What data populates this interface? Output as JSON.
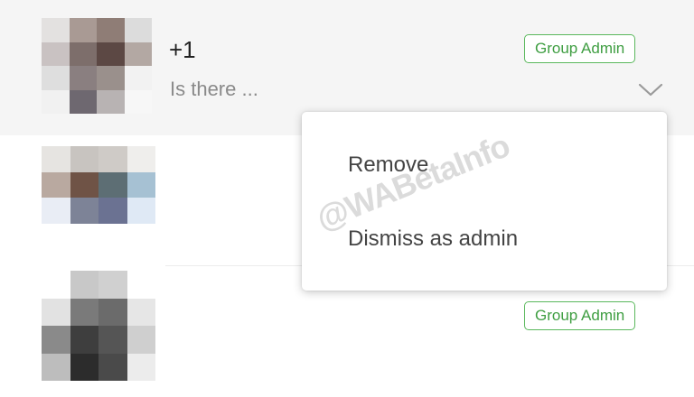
{
  "participants": [
    {
      "name": "+1",
      "preview": "Is there ...",
      "badge": "Group Admin",
      "avatar_colors": [
        "#e3e1e0",
        "#a99a94",
        "#8f7d76",
        "#dcdcdc",
        "#c9c2c2",
        "#7d6e6b",
        "#5c4844",
        "#b3a8a3",
        "#dedede",
        "#8a7f80",
        "#9a908c",
        "#f2f2f2",
        "#f1f1f1",
        "#6e6870",
        "#b8b3b3",
        "#f7f7f7"
      ]
    },
    {
      "name": "",
      "preview": "",
      "badge": "",
      "avatar_colors": [
        "#e6e4e1",
        "#c8c4c0",
        "#cfcbc7",
        "#efeeec",
        "#b9a9a0",
        "#6f5346",
        "#5d6e74",
        "#a6c1d3",
        "#e9edf5",
        "#7d8397",
        "#6b7292",
        "#dfe9f5",
        "#ffffff",
        "#ffffff",
        "#ffffff",
        "#ffffff"
      ]
    },
    {
      "name": "",
      "preview": "",
      "badge": "Group Admin",
      "avatar_colors": [
        "#ffffff",
        "#c8c8c8",
        "#d0d0d0",
        "#ffffff",
        "#e2e2e2",
        "#7a7a7a",
        "#6b6b6b",
        "#e6e6e6",
        "#8a8a8a",
        "#3e3e3e",
        "#555555",
        "#cfcfcf",
        "#bdbdbd",
        "#2c2c2c",
        "#4a4a4a",
        "#ececec"
      ]
    }
  ],
  "menu": {
    "items": [
      {
        "label": "Remove"
      },
      {
        "label": "Dismiss as admin"
      }
    ]
  },
  "watermark": "@WABetaInfo",
  "colors": {
    "accent_green": "#3f9e42",
    "selected_row_bg": "#f5f5f5"
  },
  "icons": {
    "dropdown": "chevron-down-icon"
  }
}
